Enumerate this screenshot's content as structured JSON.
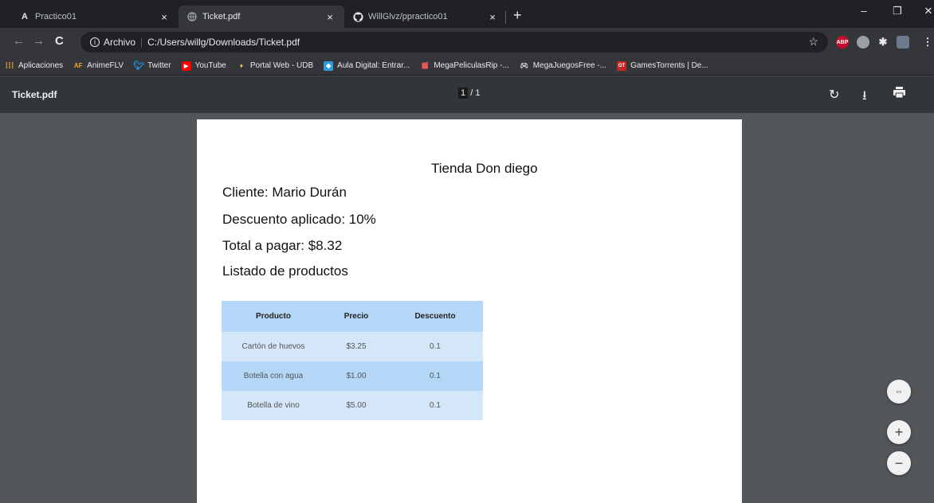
{
  "tabs": [
    {
      "label": "Practico01",
      "favicon": "A",
      "active": false
    },
    {
      "label": "Ticket.pdf",
      "active": true
    },
    {
      "label": "WillGlvz/ppractico01",
      "active": false
    }
  ],
  "tab_close_glyph": "×",
  "new_tab_glyph": "+",
  "window_controls": {
    "minimize": "–",
    "restore": "❐",
    "close": "✕"
  },
  "address": {
    "scheme_label": "Archivo",
    "url": "C:/Users/willg/Downloads/Ticket.pdf"
  },
  "bookmarks": [
    {
      "label": "Aplicaciones",
      "icon": "apps-grid-icon"
    },
    {
      "label": "AnimeFLV",
      "icon": "animeflv-icon"
    },
    {
      "label": "Twitter",
      "icon": "twitter-icon"
    },
    {
      "label": "YouTube",
      "icon": "youtube-icon"
    },
    {
      "label": "Portal Web - UDB",
      "icon": "udb-icon"
    },
    {
      "label": "Aula Digital: Entrar...",
      "icon": "aula-icon"
    },
    {
      "label": "MegaPeliculasRip -...",
      "icon": "clapper-icon"
    },
    {
      "label": "MegaJuegosFree -...",
      "icon": "gamepad-icon"
    },
    {
      "label": "GamesTorrents | De...",
      "icon": "gt-icon"
    }
  ],
  "pdf_toolbar": {
    "title": "Ticket.pdf",
    "current_page": "1",
    "total_pages": "1"
  },
  "document": {
    "store": "Tienda Don diego",
    "client": "Cliente: Mario Durán",
    "discount": "Descuento aplicado: 10%",
    "total": "Total a pagar: $8.32",
    "products_heading": "Listado de productos",
    "table": {
      "headers": [
        "Producto",
        "Precio",
        "Descuento"
      ],
      "rows": [
        [
          "Cartón de huevos",
          "$3.25",
          "0.1"
        ],
        [
          "Botella con agua",
          "$1.00",
          "0.1"
        ],
        [
          "Botella de vino",
          "$5.00",
          "0.1"
        ]
      ]
    }
  },
  "zoom": {
    "fit": "⇔",
    "in": "+",
    "out": "−"
  }
}
